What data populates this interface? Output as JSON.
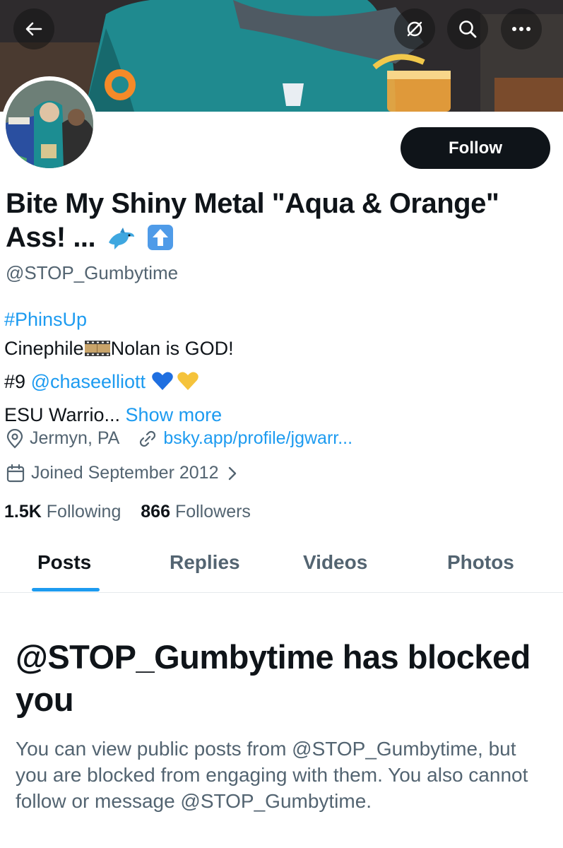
{
  "header": {
    "back_icon": "arrow-left-icon",
    "action_icons": [
      "hide-icon",
      "search-icon",
      "more-icon"
    ]
  },
  "profile": {
    "display_name": "Bite My Shiny Metal \"Aqua & Orange\" Ass! ...",
    "name_emojis": [
      "🐬",
      "⬆️"
    ],
    "handle": "@STOP_Gumbytime",
    "follow_label": "Follow"
  },
  "bio": {
    "hashtag": "#PhinsUp",
    "line2_a": "Cinephile",
    "line2_emoji": "🎞️",
    "line2_b": "Nolan is GOD!",
    "line3_a": "#9",
    "line3_mention": "@chaseelliott",
    "line3_emojis": "💙💛",
    "line4_a": "ESU Warrio...",
    "show_more": "Show more"
  },
  "meta": {
    "location": "Jermyn, PA",
    "website": "bsky.app/profile/jgwarr...",
    "joined": "Joined September 2012"
  },
  "stats": {
    "following_count": "1.5K",
    "following_label": "Following",
    "followers_count": "866",
    "followers_label": "Followers"
  },
  "tabs": [
    {
      "label": "Posts",
      "active": true
    },
    {
      "label": "Replies"
    },
    {
      "label": "Videos"
    },
    {
      "label": "Photos"
    }
  ],
  "blocked": {
    "title": "@STOP_Gumbytime has blocked you",
    "description": "You can view public posts from @STOP_Gumbytime, but you are blocked from engaging with them. You also cannot follow or message @STOP_Gumbytime."
  },
  "colors": {
    "accent": "#1d9bf0",
    "text": "#0f1419",
    "secondary": "#536471"
  }
}
